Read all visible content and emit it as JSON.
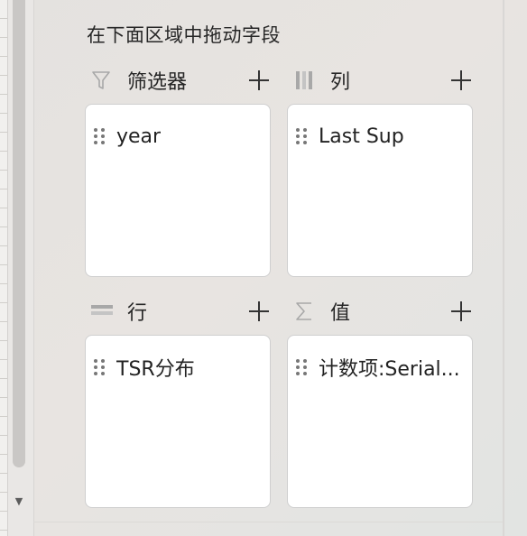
{
  "pane": {
    "heading": "在下面区域中拖动字段"
  },
  "areas": {
    "filters": {
      "label": "筛选器",
      "icon": "filter-icon",
      "add_icon": "plus-icon",
      "field": "year"
    },
    "columns": {
      "label": "列",
      "icon": "columns-icon",
      "add_icon": "plus-icon",
      "field": "Last Sup"
    },
    "rows": {
      "label": "行",
      "icon": "rows-icon",
      "add_icon": "plus-icon",
      "field": "TSR分布"
    },
    "values": {
      "label": "值",
      "icon": "sigma-icon",
      "add_icon": "plus-icon",
      "field": "计数项:Serial..."
    }
  },
  "scrollbar": {
    "arrow_icon": "triangle-down-icon"
  },
  "colors": {
    "icon_gray": "#a8a8a8",
    "text": "#262626",
    "box_border": "#cfcfcf",
    "box_bg": "#ffffff"
  }
}
